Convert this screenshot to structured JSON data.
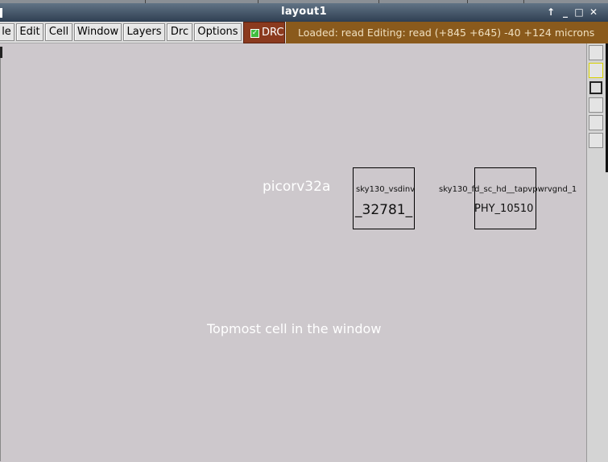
{
  "window": {
    "title": "layout1"
  },
  "menu": {
    "items": [
      "le",
      "Edit",
      "Cell",
      "Window",
      "Layers",
      "Drc",
      "Options"
    ],
    "drc_label": "DRC",
    "status": "Loaded: read Editing: read   (+845 +645) -40 +124 microns"
  },
  "canvas": {
    "top_cell_name": "picorv32a",
    "hint": "Topmost cell in the window",
    "instances": [
      {
        "cell": "sky130_vsdinv",
        "name": "_32781_"
      },
      {
        "cell": "sky130_fd_sc_hd__tapvpwrvgnd_1",
        "name": "PHY_10510"
      }
    ]
  },
  "icons": {
    "titlebar": [
      "maximize-arrow-icon",
      "restore-icon",
      "close-icon"
    ],
    "sidebar": [
      "layer-swatch-icon",
      "layer-swatch-yellow-icon",
      "layer-swatch-outline-icon",
      "layer-swatch-icon",
      "layer-swatch-icon",
      "layer-swatch-icon"
    ]
  }
}
